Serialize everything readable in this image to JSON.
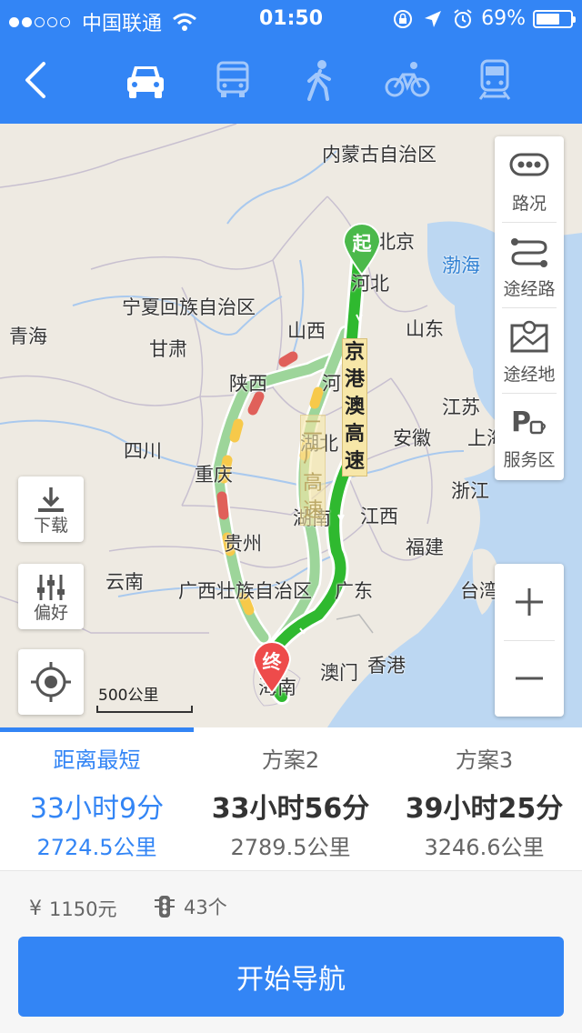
{
  "status_bar": {
    "carrier": "中国联通",
    "time": "01:50",
    "battery": "69%",
    "battery_level": 0.69
  },
  "transport_modes": [
    {
      "name": "car",
      "active": true
    },
    {
      "name": "bus",
      "active": false
    },
    {
      "name": "walk",
      "active": false
    },
    {
      "name": "bike",
      "active": false
    },
    {
      "name": "train",
      "active": false
    }
  ],
  "map": {
    "regions": [
      "内蒙古自治区",
      "北京",
      "河北",
      "渤海",
      "宁夏回族自治区",
      "山西",
      "山东",
      "青海",
      "甘肃",
      "陕西",
      "河",
      "江苏",
      "上海",
      "安徽",
      "四川",
      "湖北",
      "重庆",
      "湖南",
      "江西",
      "浙江",
      "福建",
      "贵州",
      "云南",
      "广西壮族自治区",
      "广东",
      "台湾",
      "澳门",
      "香港",
      "海南"
    ],
    "road_main": "京港澳高速",
    "road_alt": "二广高速",
    "start_label": "起",
    "end_label": "终",
    "scale_label": "500公里",
    "colors": {
      "route_main": "#2fb92f",
      "route_alt": "#9dd59a",
      "congestion": "#e0605a",
      "slow": "#f7c94a"
    }
  },
  "right_panel": {
    "traffic": "路况",
    "via_road": "途经路",
    "via_place": "途经地",
    "service": "服务区"
  },
  "left_buttons": {
    "download": "下载",
    "preference": "偏好"
  },
  "zoom": {
    "in": "+",
    "out": "−"
  },
  "routes": [
    {
      "label": "距离最短",
      "time": "33小时9分",
      "distance": "2724.5公里",
      "active": true
    },
    {
      "label": "方案2",
      "time": "33小时56分",
      "distance": "2789.5公里",
      "active": false
    },
    {
      "label": "方案3",
      "time": "39小时25分",
      "distance": "3246.6公里",
      "active": false
    }
  ],
  "summary": {
    "toll_icon": "¥",
    "toll": "1150元",
    "lights": "43个"
  },
  "start_button": "开始导航"
}
